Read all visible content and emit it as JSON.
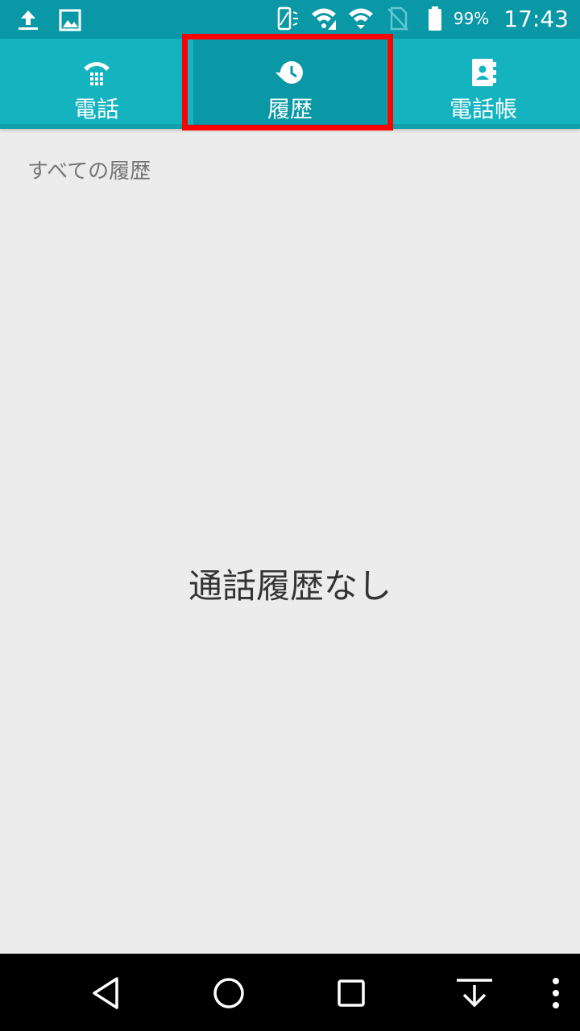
{
  "status_bar": {
    "battery_percent": "99%",
    "time": "17:43",
    "icons": [
      "upload-icon",
      "image-icon",
      "vibrate-icon",
      "wifi-icon",
      "wifi-icon",
      "no-sim-icon",
      "battery-icon"
    ]
  },
  "tabs": [
    {
      "label": "電話",
      "icon": "dialpad-phone-icon"
    },
    {
      "label": "履歴",
      "icon": "history-icon"
    },
    {
      "label": "電話帳",
      "icon": "contacts-icon"
    }
  ],
  "content": {
    "section_label": "すべての履歴",
    "empty_message": "通話履歴なし"
  },
  "colors": {
    "status_bar": "#0a97a6",
    "tab_bar": "#14b3c0",
    "tab_selected": "#0a97a6",
    "highlight": "#ff0000"
  },
  "nav_bar": {
    "buttons": [
      "back-icon",
      "home-icon",
      "recents-icon",
      "notification-pull-icon",
      "more-icon"
    ]
  }
}
